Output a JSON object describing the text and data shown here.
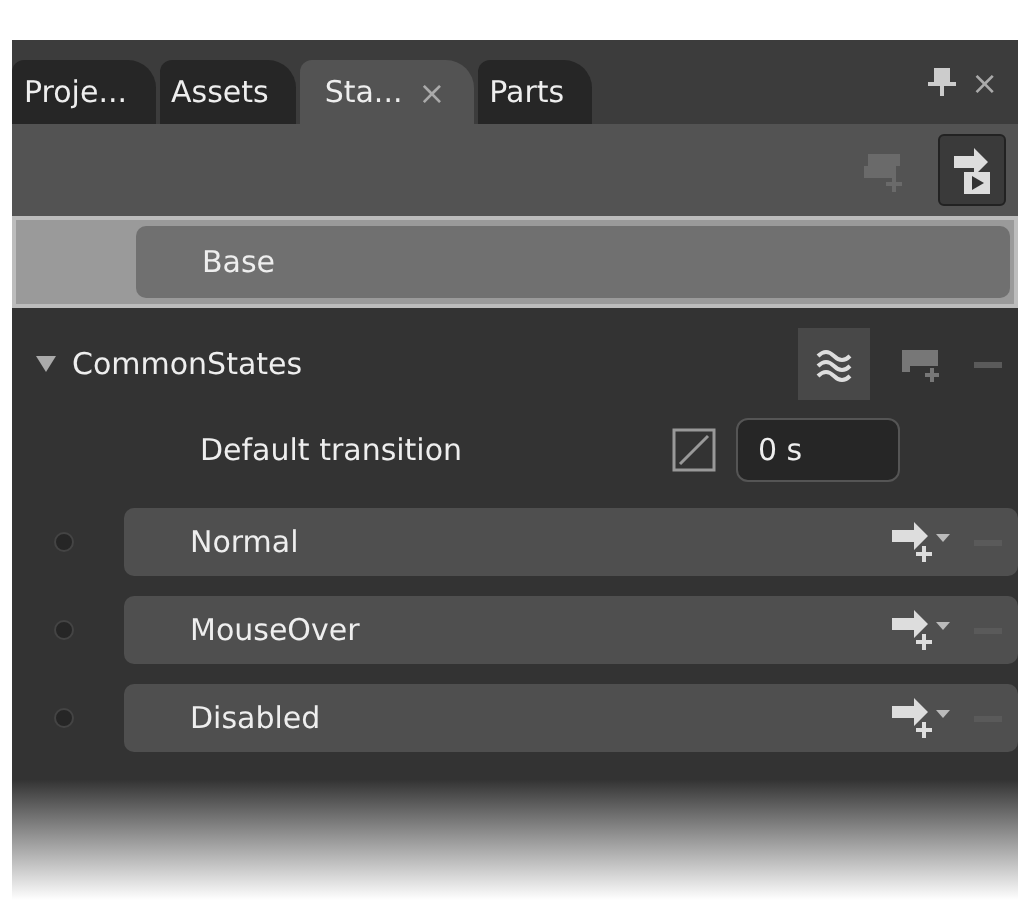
{
  "tabs": [
    {
      "label": "Proje...",
      "selected": false
    },
    {
      "label": "Assets",
      "selected": false
    },
    {
      "label": "Sta...",
      "selected": true
    },
    {
      "label": "Parts",
      "selected": false
    }
  ],
  "close_glyph": "×",
  "base": {
    "label": "Base",
    "selected": true
  },
  "group": {
    "name": "CommonStates",
    "expanded": true,
    "default_transition": {
      "label": "Default transition",
      "value": "0 s"
    }
  },
  "states": [
    {
      "label": "Normal",
      "selected": false
    },
    {
      "label": "MouseOver",
      "selected": false
    },
    {
      "label": "Disabled",
      "selected": false
    }
  ]
}
